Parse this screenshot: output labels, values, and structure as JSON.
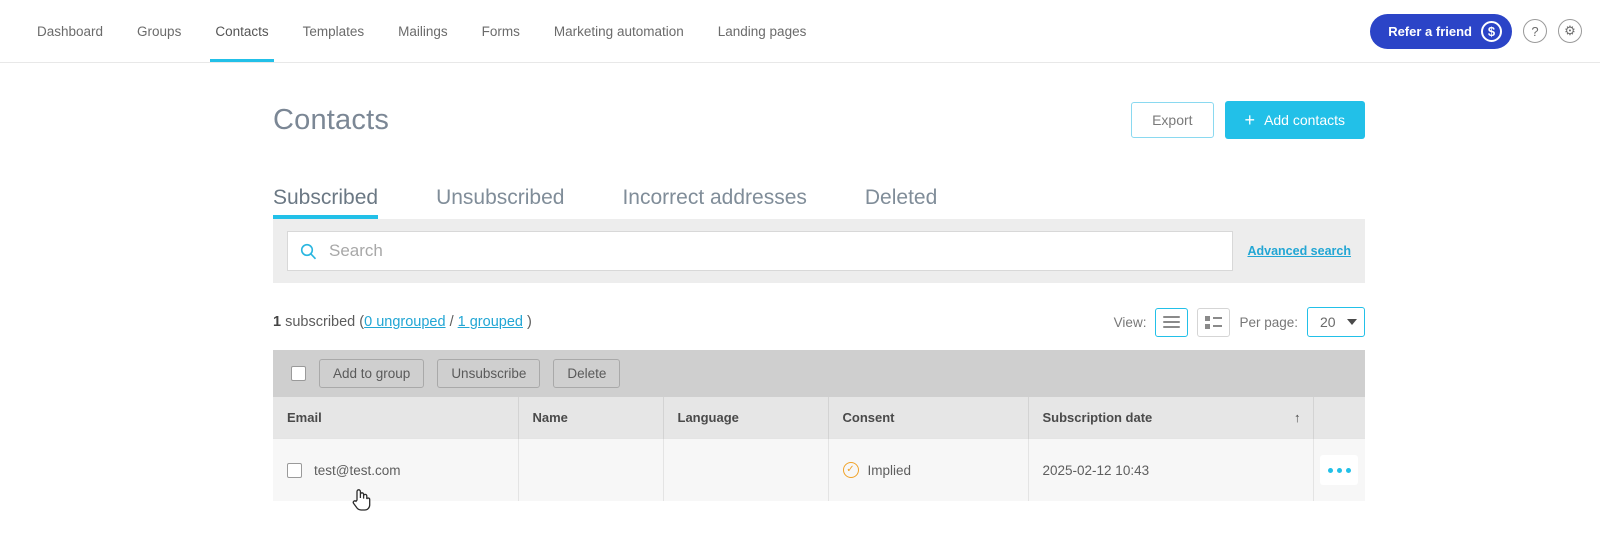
{
  "nav": {
    "items": [
      {
        "label": "Dashboard",
        "active": false
      },
      {
        "label": "Groups",
        "active": false
      },
      {
        "label": "Contacts",
        "active": true
      },
      {
        "label": "Templates",
        "active": false
      },
      {
        "label": "Mailings",
        "active": false
      },
      {
        "label": "Forms",
        "active": false
      },
      {
        "label": "Marketing automation",
        "active": false
      },
      {
        "label": "Landing pages",
        "active": false
      }
    ],
    "refer_label": "Refer a friend",
    "refer_icon": "dollar-circle-icon",
    "help_icon": "?",
    "settings_icon": "⚙",
    "refer_color": "#2b44c7"
  },
  "header": {
    "title": "Contacts",
    "export_label": "Export",
    "add_label": "Add contacts",
    "add_color": "#22c0e8"
  },
  "tabs": [
    {
      "label": "Subscribed",
      "active": true
    },
    {
      "label": "Unsubscribed",
      "active": false
    },
    {
      "label": "Incorrect addresses",
      "active": false
    },
    {
      "label": "Deleted",
      "active": false
    }
  ],
  "search": {
    "value": "",
    "placeholder": "Search",
    "advanced_label": "Advanced search"
  },
  "summary": {
    "count": "1",
    "subscribed_label": "subscribed",
    "open_paren": "(",
    "ungrouped_link": "0 ungrouped",
    "separator": "/",
    "grouped_link": "1 grouped",
    "close_paren": ")"
  },
  "view": {
    "view_label": "View:",
    "list_icon": "list-view-icon",
    "grid_icon": "grid-view-icon",
    "perpage_label": "Per page:",
    "perpage_value": "20",
    "perpage_options": [
      "20"
    ]
  },
  "toolbar": {
    "add_to_group_label": "Add to group",
    "unsubscribe_label": "Unsubscribe",
    "delete_label": "Delete"
  },
  "table": {
    "columns": [
      "Email",
      "Name",
      "Language",
      "Consent",
      "Subscription date",
      ""
    ],
    "sort_column": "Subscription date",
    "sort_arrow": "↑",
    "rows": [
      {
        "email": "test@test.com",
        "name": "",
        "language": "",
        "consent": "Implied",
        "consent_icon": "check-circle-icon",
        "consent_color": "#f0a32a",
        "subscription_date": "2025-02-12 10:43",
        "actions_icon": "more-options-icon"
      }
    ]
  }
}
